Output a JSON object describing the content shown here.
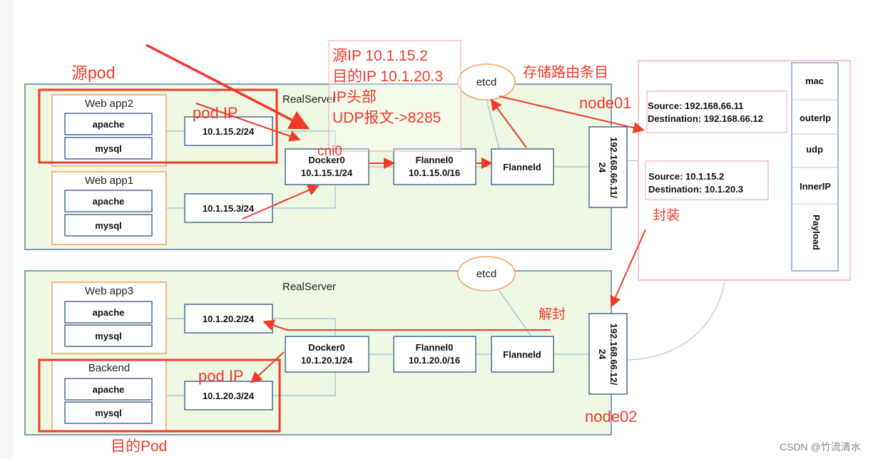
{
  "colors": {
    "server_fill": "#eef8e2",
    "server_border": "#5b7fa6",
    "pod_border": "#f5a05a",
    "annotation": "#f03a2a"
  },
  "node01": {
    "server_label": "RealServer",
    "etcd": "etcd",
    "pods": [
      {
        "name": "Web app2",
        "containers": [
          "apache",
          "mysql"
        ],
        "ip": "10.1.15.2/24"
      },
      {
        "name": "Web app1",
        "containers": [
          "apache",
          "mysql"
        ],
        "ip": "10.1.15.3/24"
      }
    ],
    "docker0": {
      "name": "Docker0",
      "ip": "10.1.15.1/24"
    },
    "flannel0": {
      "name": "Flannel0",
      "ip": "10.1.15.0/16"
    },
    "flanneld": "Flanneld",
    "nic": [
      "192.168.66.11/",
      "24"
    ]
  },
  "node02": {
    "server_label": "RealServer",
    "etcd": "etcd",
    "pods": [
      {
        "name": "Web app3",
        "containers": [
          "apache",
          "mysql"
        ],
        "ip": "10.1.20.2/24"
      },
      {
        "name": "Backend",
        "containers": [
          "apache",
          "mysql"
        ],
        "ip": "10.1.20.3/24"
      }
    ],
    "docker0": {
      "name": "Docker0",
      "ip": "10.1.20.1/24"
    },
    "flannel0": {
      "name": "Flannel0",
      "ip": "10.1.20.0/16"
    },
    "flanneld": "Flanneld",
    "nic": [
      "192.168.66.12/",
      "24"
    ]
  },
  "packet": {
    "outer": {
      "source": "Source:  192.168.66.11",
      "destination": "Destination:  192.168.66.12"
    },
    "inner": {
      "source": "Source:  10.1.15.2",
      "destination": "Destination:  10.1.20.3"
    },
    "layers": [
      "mac",
      "outerIp",
      "udp",
      "InnerIP",
      "Payload"
    ]
  },
  "annotations": {
    "source_pod": "源pod",
    "pod_ip_1": "pod IP",
    "cni0": "cni0",
    "store_routes": "存储路由条目",
    "node01": "node01",
    "encapsulate": "封装",
    "decapsulate": "解封",
    "pod_ip_2": "pod IP",
    "node02": "node02",
    "dest_pod": "目的Pod",
    "note": [
      "源IP 10.1.15.2",
      "目的IP 10.1.20.3",
      "IP头部",
      "UDP报文->8285"
    ]
  },
  "watermark": "CSDN @竹流清水"
}
